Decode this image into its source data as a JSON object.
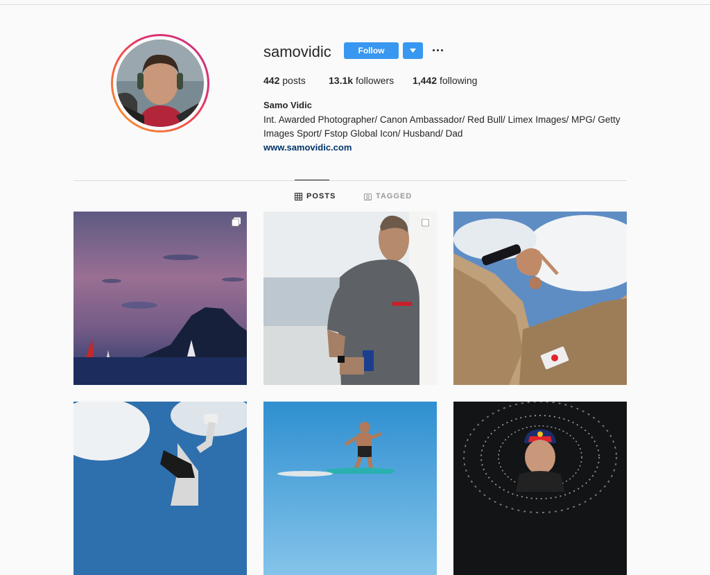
{
  "profile": {
    "username": "samovidic",
    "follow_label": "Follow",
    "full_name": "Samo Vidic",
    "bio": "Int. Awarded Photographer/ Canon Ambassador/ Red Bull/ Limex Images/ MPG/ Getty Images Sport/ Fstop Global Icon/ Husband/ Dad",
    "website": "www.samovidic.com"
  },
  "stats": {
    "posts_count": "442",
    "posts_label": "posts",
    "followers_count": "13.1k",
    "followers_label": "followers",
    "following_count": "1,442",
    "following_label": "following"
  },
  "tabs": [
    {
      "label": "POSTS",
      "active": true
    },
    {
      "label": "TAGGED",
      "active": false
    }
  ],
  "colors": {
    "follow_blue": "#3897f0",
    "link_blue": "#003569",
    "ring_orange": "#f9a12e",
    "ring_pink": "#e1306c"
  },
  "icons": {
    "dropdown": "chevron-down-icon",
    "more": "more-options-icon",
    "posts_tab": "grid-icon",
    "tagged_tab": "tagged-icon",
    "multi": "carousel-icon"
  },
  "posts": [
    {
      "subject": "sunset-sailboats",
      "multi": true
    },
    {
      "subject": "sailor-portrait",
      "multi": true
    },
    {
      "subject": "backflip-wall",
      "multi": false
    },
    {
      "subject": "breakdancer-sky",
      "multi": false
    },
    {
      "subject": "foil-surfer",
      "multi": false
    },
    {
      "subject": "water-splash-athlete",
      "multi": false
    }
  ]
}
